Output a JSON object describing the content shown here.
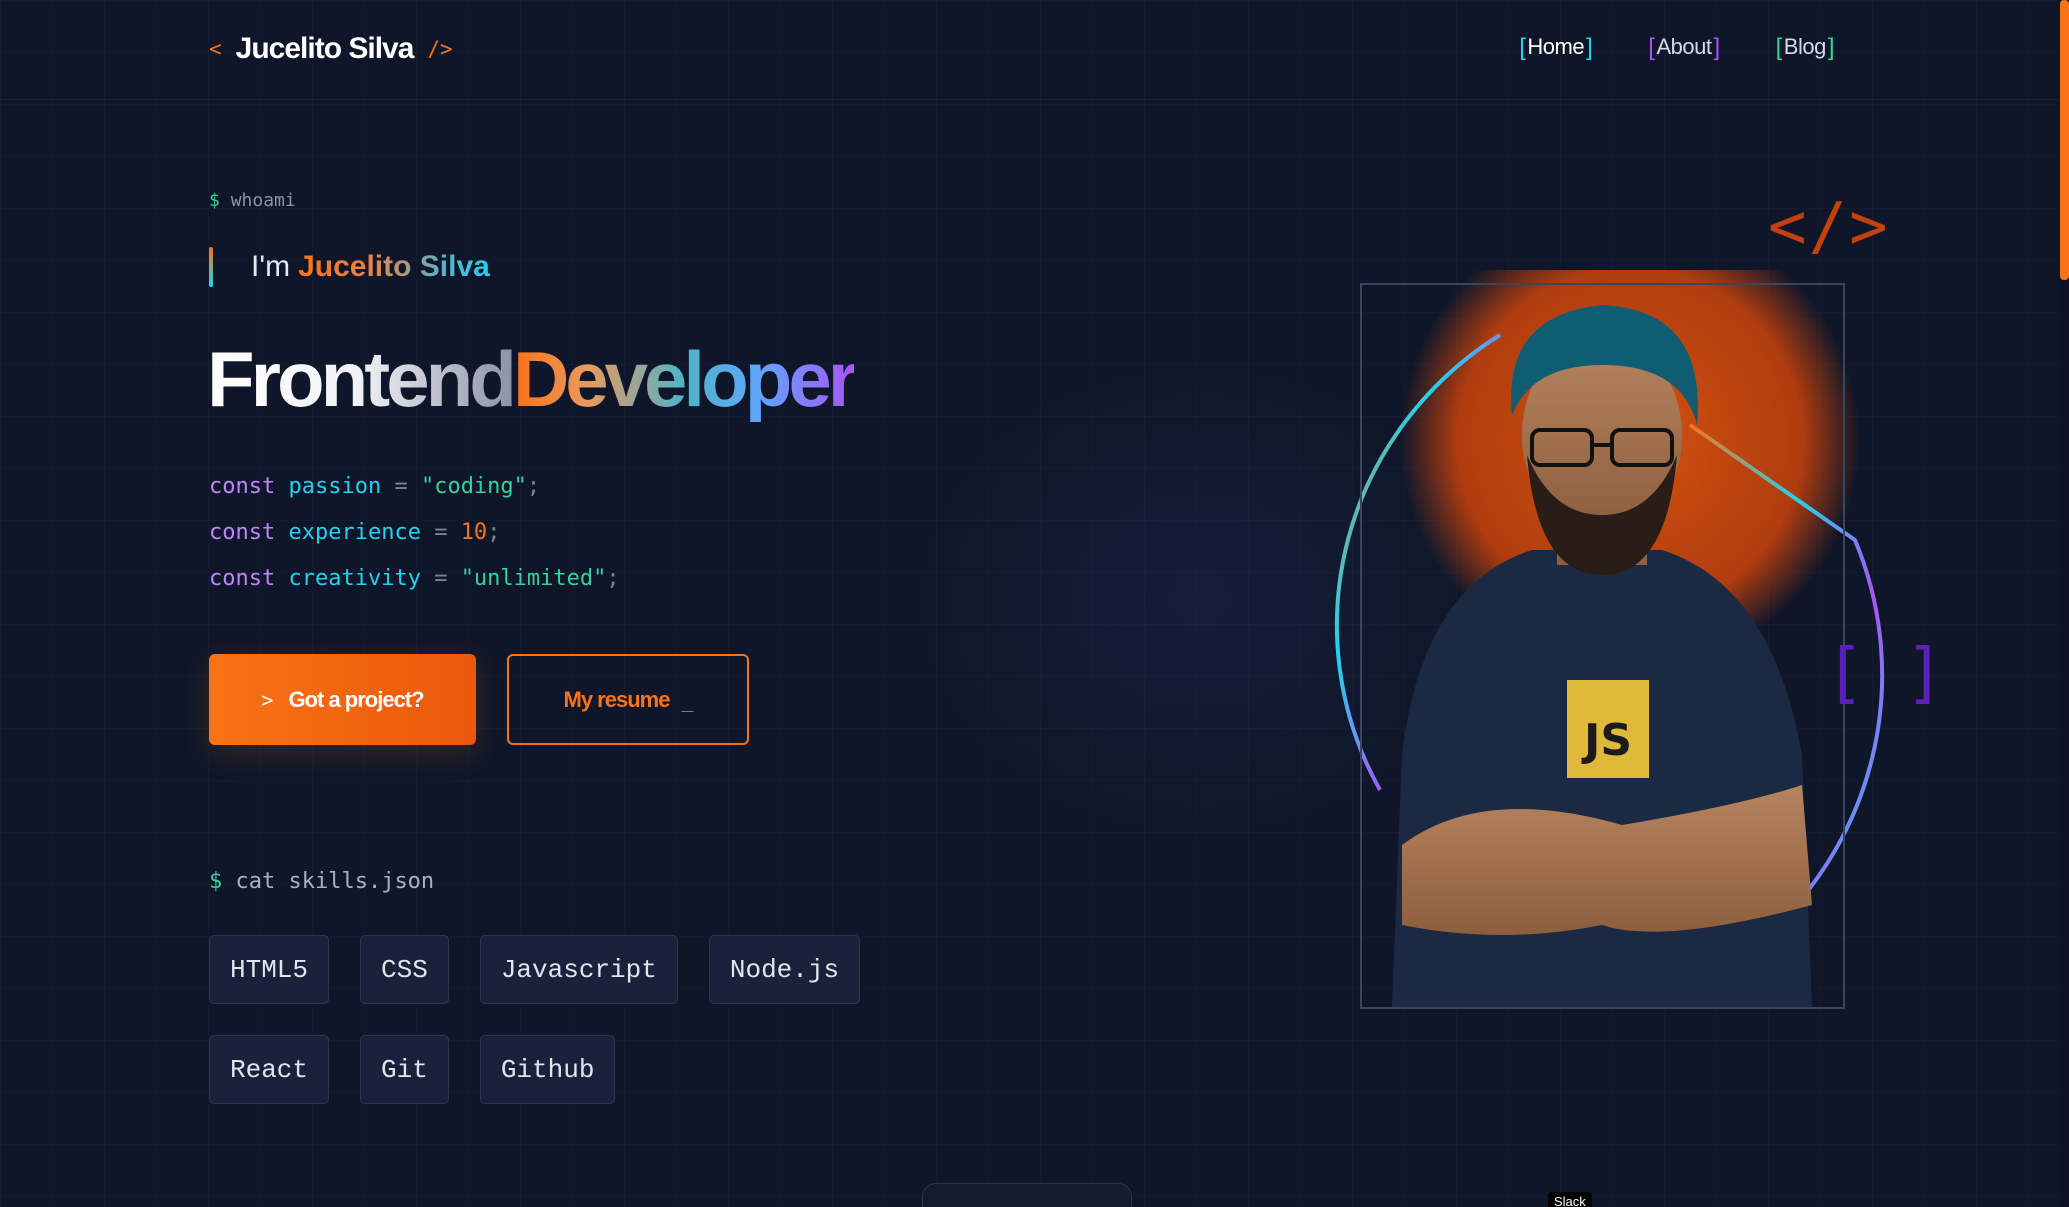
{
  "header": {
    "logo_open": "<",
    "logo_name": "Jucelito Silva",
    "logo_close": "/>",
    "nav": [
      {
        "label": "Home"
      },
      {
        "label": "About"
      },
      {
        "label": "Blog"
      }
    ]
  },
  "hero": {
    "prompt_symbol": "$",
    "prompt_cmd": "whoami",
    "intro_prefix": "I'm",
    "intro_name": "Jucelito Silva",
    "title_part1": "Frontend",
    "title_part2": "Developer",
    "code": [
      {
        "kw": "const",
        "var": "passion",
        "op": "=",
        "val": "\"coding\"",
        "end": ";"
      },
      {
        "kw": "const",
        "var": "experience",
        "op": "=",
        "val": "10",
        "end": ";"
      },
      {
        "kw": "const",
        "var": "creativity",
        "op": "=",
        "val": "\"unlimited\"",
        "end": ";"
      }
    ],
    "primary_button_prefix": ">",
    "primary_button_label": "Got a project?",
    "secondary_button_label": "My resume",
    "secondary_button_cursor": "_"
  },
  "skills": {
    "prompt_symbol": "$",
    "prompt_cmd": "cat skills.json",
    "items": [
      "HTML5",
      "CSS",
      "Javascript",
      "Node.js",
      "React",
      "Git",
      "Github"
    ]
  },
  "decor": {
    "code_symbol": "</>",
    "brackets": "[]",
    "shirt_logo": "JS"
  },
  "dock": {
    "tooltip": "Slack"
  },
  "colors": {
    "background": "#0f1629",
    "accent_orange": "#f97316",
    "accent_cyan": "#22d3ee",
    "accent_purple": "#a855f7",
    "accent_green": "#34d399"
  }
}
